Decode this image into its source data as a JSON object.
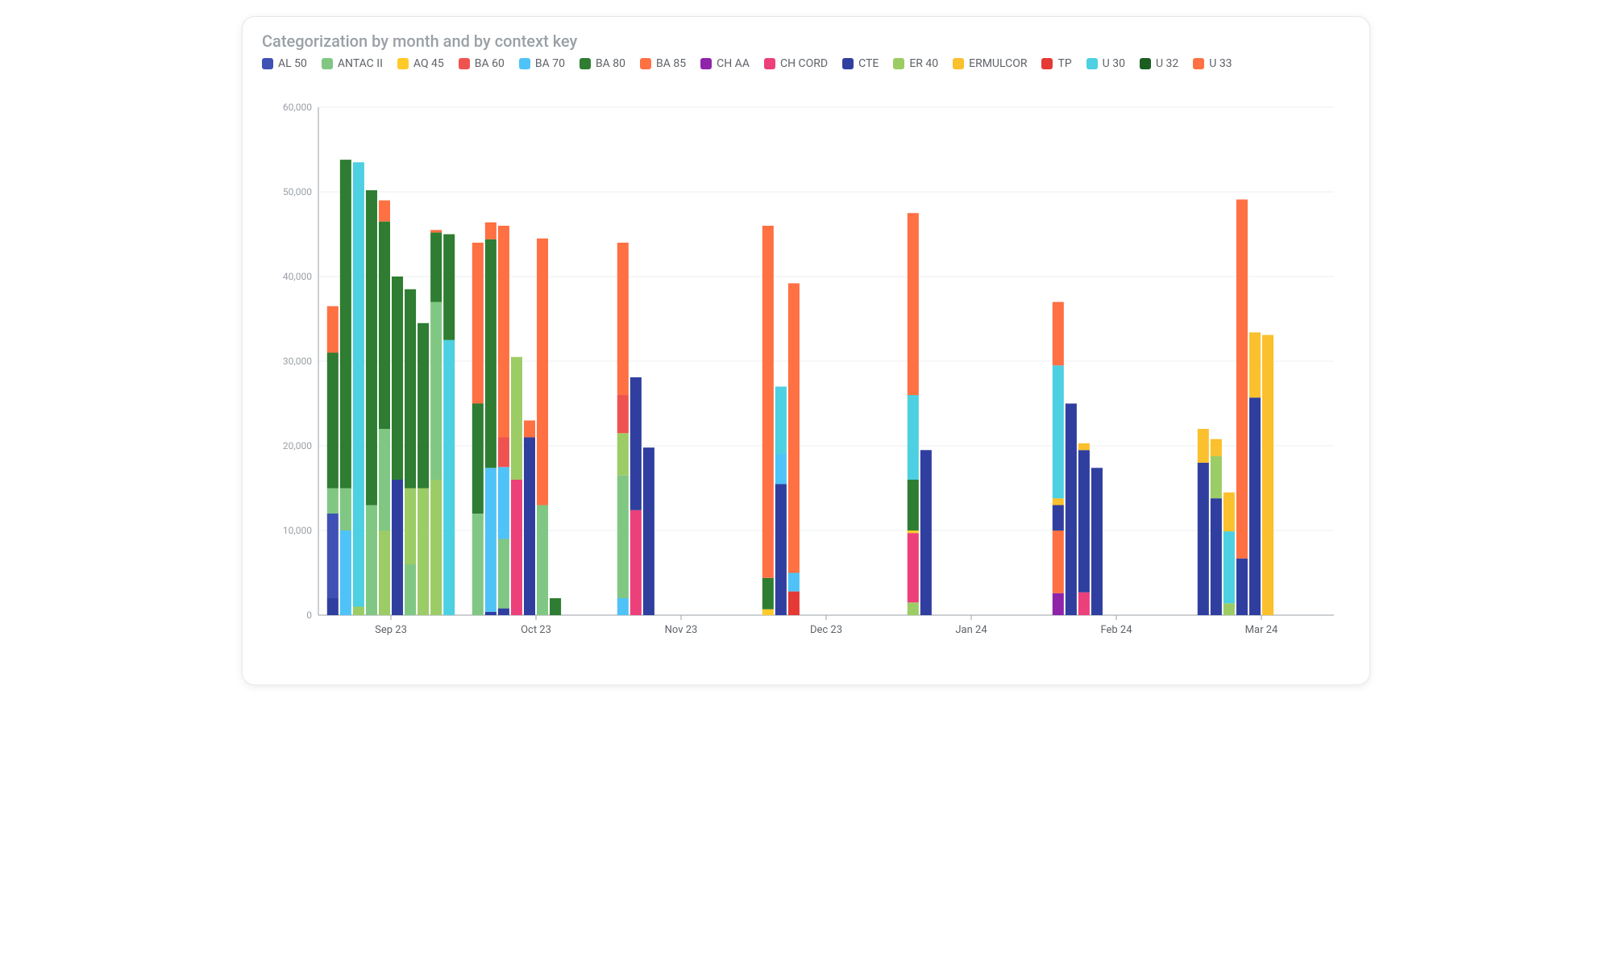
{
  "title": "Categorization by month and by context key",
  "chart_data": {
    "type": "bar",
    "title": "Categorization by month and by context key",
    "xlabel": "",
    "ylabel": "",
    "ylim": [
      0,
      60000
    ],
    "yticks": [
      0,
      10000,
      20000,
      30000,
      40000,
      50000,
      60000
    ],
    "categories": [
      "Sep 23",
      "Oct 23",
      "Nov 23",
      "Dec 23",
      "Jan 24",
      "Feb 24",
      "Mar 24"
    ],
    "series": [
      {
        "name": "AL 50",
        "color": "#3f51b5"
      },
      {
        "name": "ANTAC II",
        "color": "#81c784"
      },
      {
        "name": "AQ 45",
        "color": "#ffca28"
      },
      {
        "name": "BA 60",
        "color": "#ef5350"
      },
      {
        "name": "BA 70",
        "color": "#4fc3f7"
      },
      {
        "name": "BA 80",
        "color": "#2e7d32"
      },
      {
        "name": "BA 85",
        "color": "#ff7043"
      },
      {
        "name": "CH AA",
        "color": "#8e24aa"
      },
      {
        "name": "CH CORD",
        "color": "#ec407a"
      },
      {
        "name": "CTE",
        "color": "#303f9f"
      },
      {
        "name": "ER 40",
        "color": "#9ccc65"
      },
      {
        "name": "ERMULCOR",
        "color": "#fbc02d"
      },
      {
        "name": "TP",
        "color": "#e53935"
      },
      {
        "name": "U 30",
        "color": "#4dd0e1"
      },
      {
        "name": "U 32",
        "color": "#1b5e20"
      },
      {
        "name": "U 33",
        "color": "#ff7043"
      }
    ],
    "bars_per_group": 10,
    "groups": [
      {
        "month": "Sep 23",
        "bars": [
          {
            "segments": [
              {
                "series": "CTE",
                "value": 2000
              },
              {
                "series": "AL 50",
                "value": 10000
              },
              {
                "series": "ANTAC II",
                "value": 3000
              },
              {
                "series": "BA 80",
                "value": 16000
              },
              {
                "series": "BA 85",
                "value": 5500
              }
            ]
          },
          {
            "segments": [
              {
                "series": "BA 70",
                "value": 10000
              },
              {
                "series": "ANTAC II",
                "value": 5000
              },
              {
                "series": "BA 80",
                "value": 38800
              }
            ]
          },
          {
            "segments": [
              {
                "series": "ER 40",
                "value": 1000
              },
              {
                "series": "U 30",
                "value": 52500
              }
            ]
          },
          {
            "segments": [
              {
                "series": "ANTAC II",
                "value": 13000
              },
              {
                "series": "BA 80",
                "value": 37200
              }
            ]
          },
          {
            "segments": [
              {
                "series": "ER 40",
                "value": 10000
              },
              {
                "series": "ANTAC II",
                "value": 12000
              },
              {
                "series": "BA 80",
                "value": 24500
              },
              {
                "series": "BA 85",
                "value": 2500
              }
            ]
          },
          {
            "segments": [
              {
                "series": "CTE",
                "value": 16000
              },
              {
                "series": "BA 80",
                "value": 24000
              }
            ]
          },
          {
            "segments": [
              {
                "series": "ANTAC II",
                "value": 6000
              },
              {
                "series": "ER 40",
                "value": 9000
              },
              {
                "series": "BA 80",
                "value": 23500
              }
            ]
          },
          {
            "segments": [
              {
                "series": "ER 40",
                "value": 15000
              },
              {
                "series": "BA 80",
                "value": 19500
              }
            ]
          },
          {
            "segments": [
              {
                "series": "ER 40",
                "value": 16000
              },
              {
                "series": "ANTAC II",
                "value": 21000
              },
              {
                "series": "BA 80",
                "value": 8200
              },
              {
                "series": "BA 85",
                "value": 300
              }
            ]
          },
          {
            "segments": [
              {
                "series": "U 30",
                "value": 32500
              },
              {
                "series": "BA 80",
                "value": 12500
              }
            ]
          }
        ]
      },
      {
        "month": "Oct 23",
        "bars": [
          {
            "segments": [
              {
                "series": "ANTAC II",
                "value": 12000
              },
              {
                "series": "BA 80",
                "value": 13000
              },
              {
                "series": "BA 85",
                "value": 19000
              }
            ]
          },
          {
            "segments": [
              {
                "series": "CTE",
                "value": 400
              },
              {
                "series": "BA 70",
                "value": 17000
              },
              {
                "series": "BA 80",
                "value": 27000
              },
              {
                "series": "BA 85",
                "value": 2000
              }
            ]
          },
          {
            "segments": [
              {
                "series": "CTE",
                "value": 800
              },
              {
                "series": "ANTAC II",
                "value": 8200
              },
              {
                "series": "BA 70",
                "value": 8500
              },
              {
                "series": "BA 60",
                "value": 3500
              },
              {
                "series": "BA 85",
                "value": 25000
              }
            ]
          },
          {
            "segments": [
              {
                "series": "CH CORD",
                "value": 16000
              },
              {
                "series": "ER 40",
                "value": 14500
              }
            ]
          },
          {
            "segments": [
              {
                "series": "CTE",
                "value": 21000
              },
              {
                "series": "BA 85",
                "value": 2000
              }
            ]
          },
          {
            "segments": [
              {
                "series": "ANTAC II",
                "value": 13000
              },
              {
                "series": "BA 85",
                "value": 31500
              }
            ]
          },
          {
            "segments": [
              {
                "series": "BA 80",
                "value": 2000
              }
            ]
          },
          {
            "segments": []
          },
          {
            "segments": []
          },
          {
            "segments": []
          }
        ]
      },
      {
        "month": "Nov 23",
        "bars": [
          {
            "segments": [
              {
                "series": "BA 70",
                "value": 2000
              },
              {
                "series": "ANTAC II",
                "value": 14500
              },
              {
                "series": "ER 40",
                "value": 5000
              },
              {
                "series": "BA 60",
                "value": 4500
              },
              {
                "series": "BA 85",
                "value": 18000
              }
            ]
          },
          {
            "segments": [
              {
                "series": "CH CORD",
                "value": 12400
              },
              {
                "series": "CTE",
                "value": 15700
              }
            ]
          },
          {
            "segments": [
              {
                "series": "CTE",
                "value": 19800
              }
            ]
          },
          {
            "segments": []
          },
          {
            "segments": []
          },
          {
            "segments": []
          },
          {
            "segments": []
          },
          {
            "segments": []
          },
          {
            "segments": []
          },
          {
            "segments": []
          }
        ]
      },
      {
        "month": "Dec 23",
        "bars": [
          {
            "segments": [
              {
                "series": "AQ 45",
                "value": 700
              },
              {
                "series": "BA 80",
                "value": 3700
              },
              {
                "series": "BA 85",
                "value": 41600
              }
            ]
          },
          {
            "segments": [
              {
                "series": "CTE",
                "value": 15500
              },
              {
                "series": "BA 70",
                "value": 3500
              },
              {
                "series": "U 30",
                "value": 8000
              }
            ]
          },
          {
            "segments": [
              {
                "series": "TP",
                "value": 2800
              },
              {
                "series": "BA 70",
                "value": 2200
              },
              {
                "series": "BA 85",
                "value": 34200
              }
            ]
          },
          {
            "segments": []
          },
          {
            "segments": []
          },
          {
            "segments": []
          },
          {
            "segments": []
          },
          {
            "segments": []
          },
          {
            "segments": []
          },
          {
            "segments": []
          }
        ]
      },
      {
        "month": "Jan 24",
        "bars": [
          {
            "segments": [
              {
                "series": "ER 40",
                "value": 1500
              },
              {
                "series": "CH CORD",
                "value": 8200
              },
              {
                "series": "AQ 45",
                "value": 300
              },
              {
                "series": "BA 80",
                "value": 6000
              },
              {
                "series": "U 30",
                "value": 10000
              },
              {
                "series": "BA 85",
                "value": 21500
              }
            ]
          },
          {
            "segments": [
              {
                "series": "CTE",
                "value": 19500
              }
            ]
          },
          {
            "segments": []
          },
          {
            "segments": []
          },
          {
            "segments": []
          },
          {
            "segments": []
          },
          {
            "segments": []
          },
          {
            "segments": []
          },
          {
            "segments": []
          },
          {
            "segments": []
          }
        ]
      },
      {
        "month": "Feb 24",
        "bars": [
          {
            "segments": [
              {
                "series": "CH AA",
                "value": 2600
              },
              {
                "series": "BA 85",
                "value": 7400
              },
              {
                "series": "CTE",
                "value": 3000
              },
              {
                "series": "ERMULCOR",
                "value": 800
              },
              {
                "series": "U 30",
                "value": 15700
              },
              {
                "series": "U 33",
                "value": 7500
              }
            ]
          },
          {
            "segments": [
              {
                "series": "CTE",
                "value": 25000
              }
            ]
          },
          {
            "segments": [
              {
                "series": "CH CORD",
                "value": 2700
              },
              {
                "series": "CTE",
                "value": 16800
              },
              {
                "series": "ERMULCOR",
                "value": 800
              }
            ]
          },
          {
            "segments": [
              {
                "series": "CTE",
                "value": 17400
              }
            ]
          },
          {
            "segments": []
          },
          {
            "segments": []
          },
          {
            "segments": []
          },
          {
            "segments": []
          },
          {
            "segments": []
          },
          {
            "segments": []
          }
        ]
      },
      {
        "month": "Mar 24",
        "bars": [
          {
            "segments": [
              {
                "series": "CTE",
                "value": 18000
              },
              {
                "series": "ERMULCOR",
                "value": 4000
              }
            ]
          },
          {
            "segments": [
              {
                "series": "CTE",
                "value": 13800
              },
              {
                "series": "ER 40",
                "value": 5000
              },
              {
                "series": "ERMULCOR",
                "value": 2000
              }
            ]
          },
          {
            "segments": [
              {
                "series": "ER 40",
                "value": 1400
              },
              {
                "series": "U 30",
                "value": 8500
              },
              {
                "series": "ERMULCOR",
                "value": 4600
              }
            ]
          },
          {
            "segments": [
              {
                "series": "CTE",
                "value": 6700
              },
              {
                "series": "BA 85",
                "value": 42400
              }
            ]
          },
          {
            "segments": [
              {
                "series": "CTE",
                "value": 25700
              },
              {
                "series": "ERMULCOR",
                "value": 7700
              }
            ]
          },
          {
            "segments": [
              {
                "series": "ERMULCOR",
                "value": 33100
              }
            ]
          },
          {
            "segments": []
          },
          {
            "segments": []
          },
          {
            "segments": []
          },
          {
            "segments": []
          }
        ]
      }
    ]
  }
}
